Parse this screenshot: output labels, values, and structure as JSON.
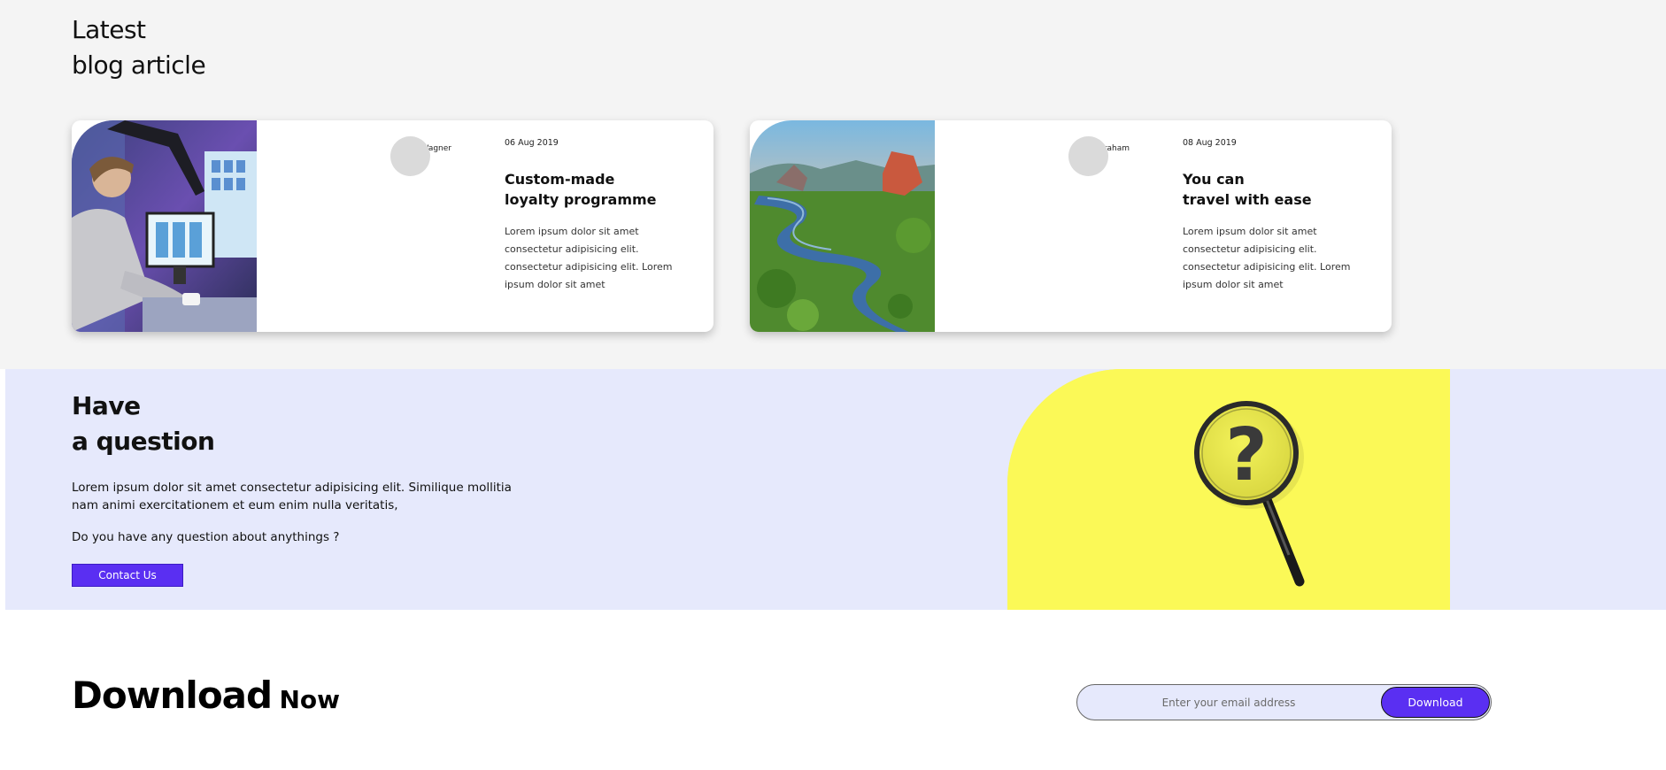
{
  "blog": {
    "title_line1": "Latest",
    "title_line2": "blog article",
    "articles": [
      {
        "author": "Bobby Wagner",
        "date": "06 Aug 2019",
        "title_line1": "Custom-made",
        "title_line2": "loyalty programme",
        "excerpt": "Lorem ipsum dolor sit amet consectetur adipisicing elit. consectetur adipisicing elit. Lorem ipsum dolor sit amet",
        "image_icon": "person-at-computer-image"
      },
      {
        "author": "Gloria Graham",
        "date": "08 Aug 2019",
        "title_line1": "You can",
        "title_line2": "travel with ease",
        "excerpt": "Lorem ipsum dolor sit amet consectetur adipisicing elit. consectetur adipisicing elit. Lorem ipsum dolor sit amet",
        "image_icon": "river-landscape-image"
      }
    ]
  },
  "question": {
    "title_line1": "Have",
    "title_line2": "a question",
    "text": "Lorem ipsum dolor sit amet consectetur adipisicing elit. Similique mollitia nam animi exercitationem et eum enim nulla veritatis,",
    "ask": "Do you have any question about anythings ?",
    "contact_label": "Contact Us",
    "image_icon": "magnifying-glass-question-image"
  },
  "download": {
    "title_big": "Download",
    "title_small": "Now",
    "placeholder": "Enter your email address",
    "button_label": "Download"
  },
  "colors": {
    "accent": "#5a2ff2",
    "lavender": "#e6e9fc",
    "yellow": "#fbf957"
  }
}
